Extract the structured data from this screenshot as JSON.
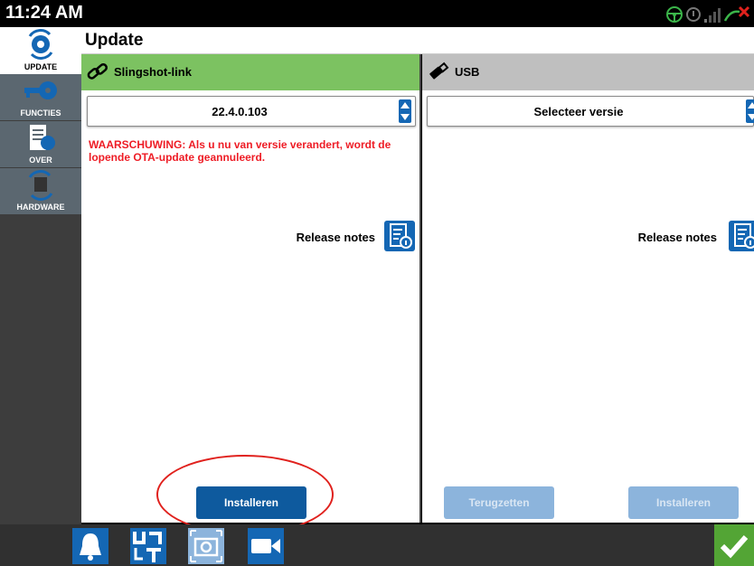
{
  "status": {
    "time": "11:24 AM"
  },
  "sidebar": {
    "items": [
      {
        "label": "UPDATE",
        "icon": "gear-sync-icon",
        "active": true
      },
      {
        "label": "FUNCTIES",
        "icon": "key-icon",
        "active": false
      },
      {
        "label": "OVER",
        "icon": "document-gear-icon",
        "active": false
      },
      {
        "label": "HARDWARE",
        "icon": "hardware-sync-icon",
        "active": false
      }
    ]
  },
  "header": {
    "title": "Update"
  },
  "left_panel": {
    "title": "Slingshot-link",
    "icon": "link-icon",
    "version_value": "22.4.0.103",
    "warning": "WAARSCHUWING: Als u nu van versie verandert, wordt de lopende OTA-update geannuleerd.",
    "release_notes_label": "Release notes",
    "install_label": "Installeren"
  },
  "right_panel": {
    "title": "USB",
    "icon": "usb-icon",
    "version_placeholder": "Selecteer versie",
    "release_notes_label": "Release notes",
    "revert_label": "Terugzetten",
    "install_label": "Installeren"
  },
  "bottombar": {
    "buttons": [
      "bell-icon",
      "ut-icon",
      "screenshot-icon",
      "camera-icon"
    ],
    "confirm_icon": "checkmark-icon"
  },
  "colors": {
    "accent_blue": "#1467b4",
    "header_green": "#7cc261",
    "warning_red": "#ee1c25",
    "confirm_green": "#53a535"
  }
}
